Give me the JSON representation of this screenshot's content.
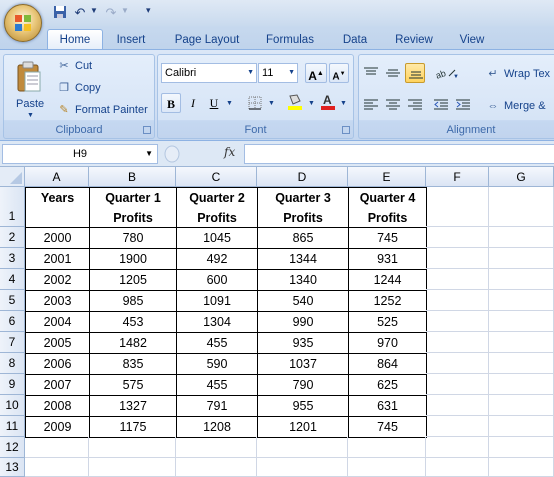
{
  "tabs": [
    "Home",
    "Insert",
    "Page Layout",
    "Formulas",
    "Data",
    "Review",
    "View"
  ],
  "clipboard": {
    "paste": "Paste",
    "cut": "Cut",
    "copy": "Copy",
    "format_painter": "Format Painter",
    "label": "Clipboard"
  },
  "font": {
    "name": "Calibri",
    "size": "11",
    "label": "Font"
  },
  "alignment": {
    "wrap_text": "Wrap Tex",
    "merge": "Merge &",
    "label": "Alignment"
  },
  "formula_bar": {
    "name_box": "H9",
    "fx": "fx",
    "formula": ""
  },
  "sheet": {
    "columns": [
      "A",
      "B",
      "C",
      "D",
      "E",
      "F",
      "G"
    ],
    "rows": [
      "1",
      "2",
      "3",
      "4",
      "5",
      "6",
      "7",
      "8",
      "9",
      "10",
      "11",
      "12",
      "13"
    ],
    "header_row": [
      [
        "Years"
      ],
      [
        "Quarter 1",
        "Profits"
      ],
      [
        "Quarter 2",
        "Profits"
      ],
      [
        "Quarter 3",
        "Profits"
      ],
      [
        "Quarter 4",
        "Profits"
      ]
    ],
    "data": [
      [
        "2000",
        "780",
        "1045",
        "865",
        "745"
      ],
      [
        "2001",
        "1900",
        "492",
        "1344",
        "931"
      ],
      [
        "2002",
        "1205",
        "600",
        "1340",
        "1244"
      ],
      [
        "2003",
        "985",
        "1091",
        "540",
        "1252"
      ],
      [
        "2004",
        "453",
        "1304",
        "990",
        "525"
      ],
      [
        "2005",
        "1482",
        "455",
        "935",
        "970"
      ],
      [
        "2006",
        "835",
        "590",
        "1037",
        "864"
      ],
      [
        "2007",
        "575",
        "455",
        "790",
        "625"
      ],
      [
        "2008",
        "1327",
        "791",
        "955",
        "631"
      ],
      [
        "2009",
        "1175",
        "1208",
        "1201",
        "745"
      ]
    ]
  },
  "colors": {
    "accent": "#15428b",
    "highlight_fill": "#ffd35e",
    "font_color_bar": "#e02020",
    "fill_color_bar": "#ffff00"
  }
}
